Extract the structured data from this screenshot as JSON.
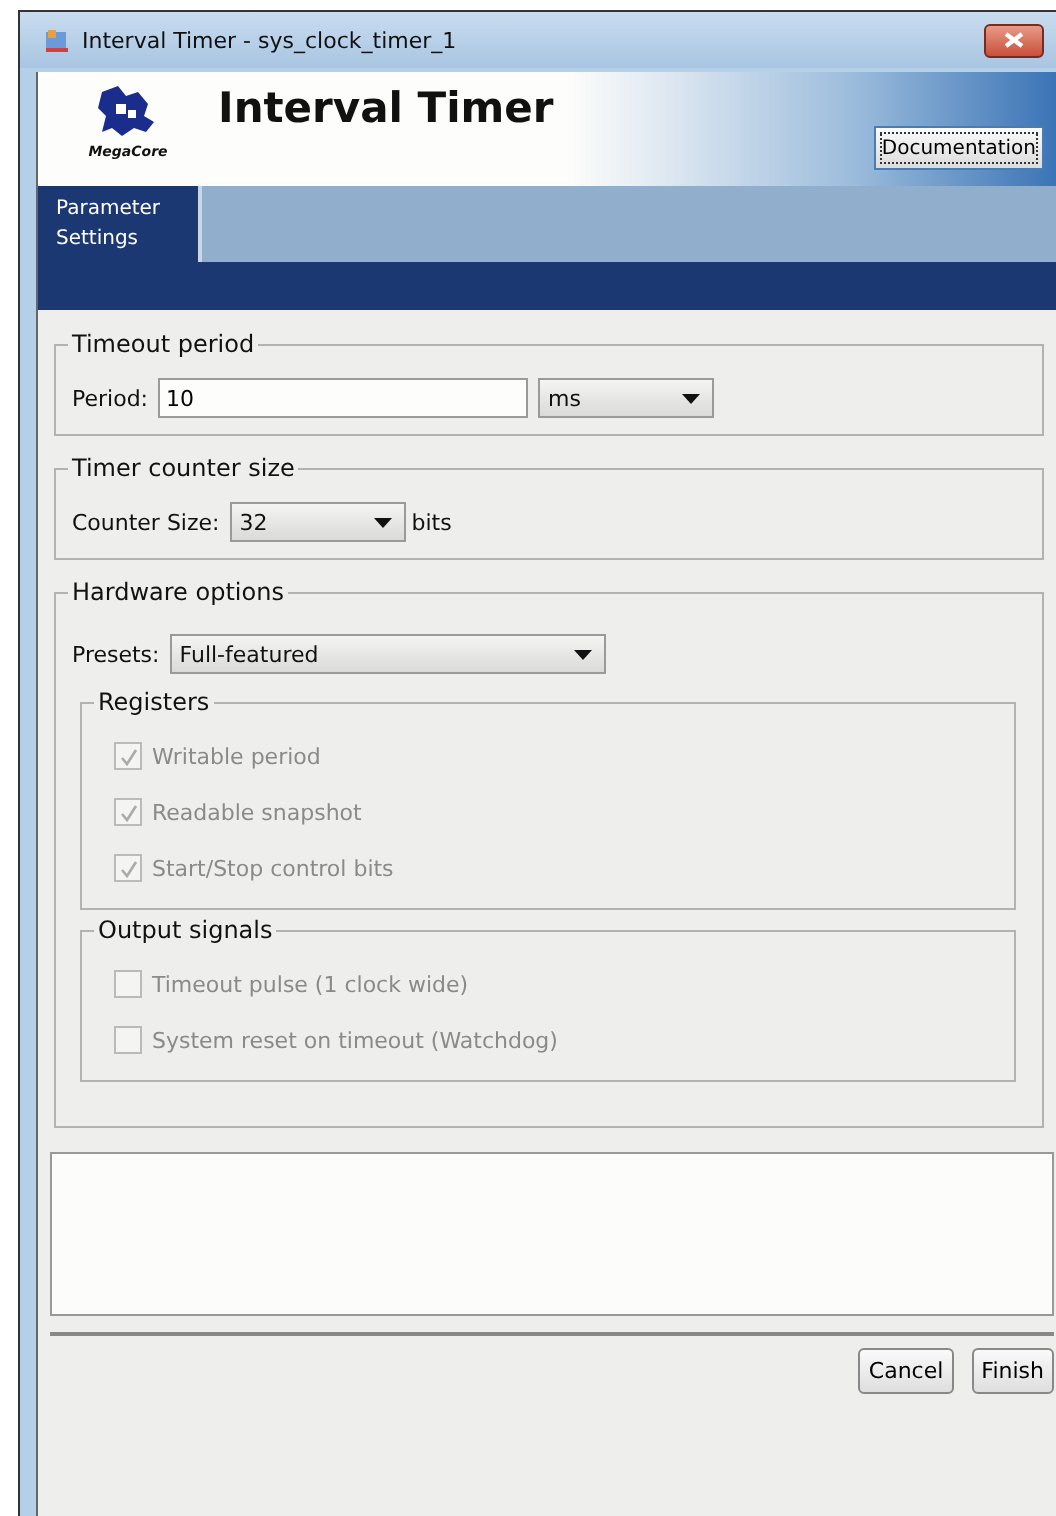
{
  "window": {
    "title": "Interval Timer - sys_clock_timer_1"
  },
  "header": {
    "logo_text": "MegaCore",
    "title": "Interval Timer",
    "documentation_button": "Documentation"
  },
  "tabs": [
    {
      "label": "Parameter Settings",
      "selected": true
    }
  ],
  "timeout_period": {
    "title": "Timeout period",
    "label": "Period:",
    "value": "10",
    "unit": "ms"
  },
  "timer_counter_size": {
    "title": "Timer counter size",
    "label": "Counter Size:",
    "value": "32",
    "suffix": "bits"
  },
  "hardware_options": {
    "title": "Hardware options",
    "presets_label": "Presets:",
    "presets_value": "Full-featured",
    "groups": [
      {
        "title": "Registers",
        "options": [
          {
            "label": "Writable period",
            "checked": true,
            "disabled": true
          },
          {
            "label": "Readable snapshot",
            "checked": true,
            "disabled": true
          },
          {
            "label": "Start/Stop control bits",
            "checked": true,
            "disabled": true
          }
        ]
      },
      {
        "title": "Output signals",
        "options": [
          {
            "label": "Timeout pulse (1 clock wide)",
            "checked": false,
            "disabled": true
          },
          {
            "label": "System reset on timeout (Watchdog)",
            "checked": false,
            "disabled": true
          }
        ]
      }
    ]
  },
  "buttons": [
    "Cancel",
    "Finish"
  ]
}
